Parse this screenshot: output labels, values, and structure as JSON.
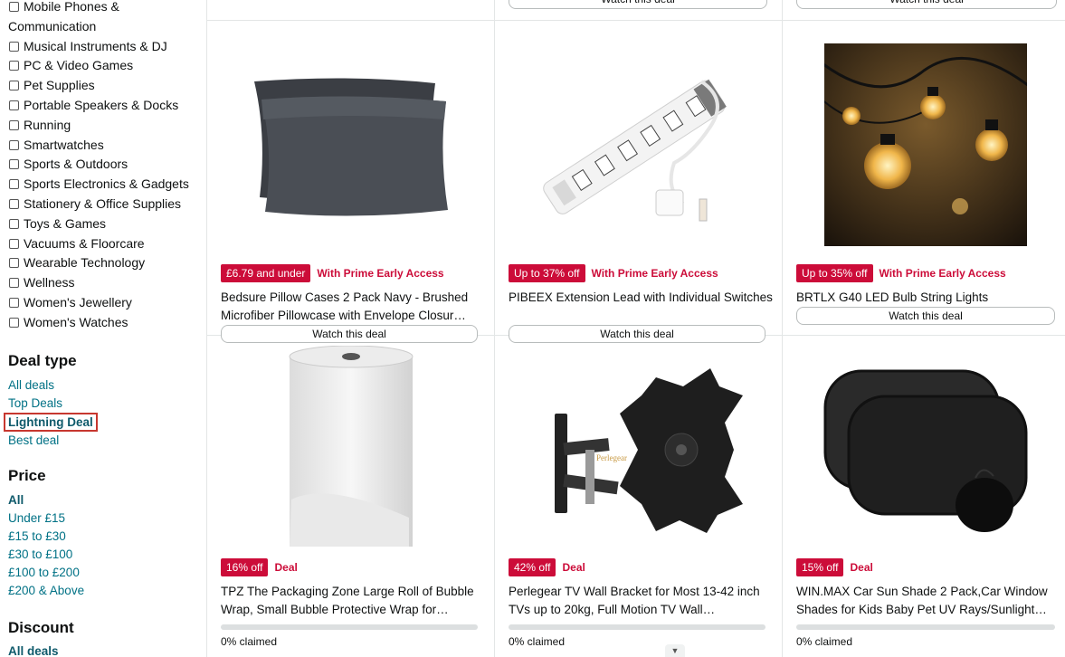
{
  "sidebar": {
    "categories": [
      "Mobile Phones &",
      "Communication",
      "Musical Instruments & DJ",
      "PC & Video Games",
      "Pet Supplies",
      "Portable Speakers & Docks",
      "Running",
      "Smartwatches",
      "Sports & Outdoors",
      "Sports Electronics & Gadgets",
      "Stationery & Office Supplies",
      "Toys & Games",
      "Vacuums & Floorcare",
      "Wearable Technology",
      "Wellness",
      "Women's Jewellery",
      "Women's Watches"
    ],
    "deal_type": {
      "title": "Deal type",
      "items": [
        "All deals",
        "Top Deals",
        "Lightning Deal",
        "Best deal"
      ]
    },
    "price": {
      "title": "Price",
      "items": [
        "All",
        "Under £15",
        "£15 to £30",
        "£30 to £100",
        "£100 to £200",
        "£200 & Above"
      ]
    },
    "discount": {
      "title": "Discount",
      "items": [
        "All deals"
      ]
    }
  },
  "top_row": {
    "buttons": [
      "Watch this deal",
      "Watch this deal"
    ]
  },
  "products": [
    {
      "badge": "£6.79 and under",
      "label": "With Prime Early Access",
      "title": "Bedsure Pillow Cases 2 Pack Navy - Brushed Microfiber Pillowcase with Envelope Closur…",
      "action": "Watch this deal"
    },
    {
      "badge": "Up to 37% off",
      "label": "With Prime Early Access",
      "title": "PIBEEX Extension Lead with Individual Switches",
      "action": "Watch this deal"
    },
    {
      "badge": "Up to 35% off",
      "label": "With Prime Early Access",
      "title": "BRTLX G40 LED Bulb String Lights",
      "action": "Watch this deal"
    },
    {
      "badge": "16% off",
      "label": "Deal",
      "title": "TPZ The Packaging Zone Large Roll of Bubble Wrap, Small Bubble Protective Wrap for…",
      "claimed": "0% claimed",
      "claimed_fraction": 0
    },
    {
      "badge": "42% off",
      "label": "Deal",
      "title": "Perlegear TV Wall Bracket for Most 13-42 inch TVs up to 20kg, Full Motion TV Wall…",
      "claimed": "0% claimed",
      "claimed_fraction": 0,
      "brand_mark": "Perlegear"
    },
    {
      "badge": "15% off",
      "label": "Deal",
      "title": "WIN.MAX Car Sun Shade 2 Pack,Car Window Shades for Kids Baby Pet UV Rays/Sunlight…",
      "claimed": "0% claimed",
      "claimed_fraction": 0
    }
  ],
  "colors": {
    "deal_red": "#cc0c39",
    "link_teal": "#007185",
    "highlight_border": "#c7372f"
  }
}
